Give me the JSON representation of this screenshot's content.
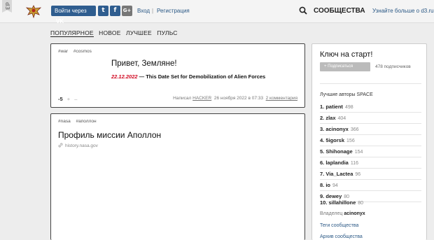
{
  "header": {
    "badge": "d3",
    "login_via": "Войти через",
    "login_vk": "VK",
    "twitter": "t",
    "facebook": "f",
    "gplus": "G+",
    "login": "Вход",
    "separator": "|",
    "register": "Регистрация",
    "communities": "СООБЩЕСТВА",
    "learn_more": "Узнайте больше о d3.ru"
  },
  "tabs": [
    "ПОПУЛЯРНОЕ",
    "НОВОЕ",
    "ЛУЧШЕЕ",
    "ПУЛЬС"
  ],
  "posts": [
    {
      "tags": [
        "#war",
        "#cosmos"
      ],
      "title": "Привет, Земляне!",
      "sub_date": "22.12.2022",
      "sub_text": " — This Date Set for Demobilization of Alien Forces",
      "rating": "-5",
      "vote_up": "+",
      "vote_down": "–",
      "meta_written": "Написал",
      "author": "HACKER",
      "date": "26 ноября 2022 в 07:33",
      "comments": "2 комментария"
    },
    {
      "tags": [
        "#nasa",
        "#аполлон"
      ],
      "title": "Профиль миссии Аполлон",
      "link": "history.nasa.gov"
    }
  ],
  "sidebar": {
    "title": "Ключ на старт!",
    "subscribe": "Подписаться",
    "subscribers": "478 подписчиков",
    "top_authors_heading": "Лучшие авторы SPACE",
    "authors": [
      {
        "name": "1. patient",
        "score": "498"
      },
      {
        "name": "2. zlax",
        "score": "404"
      },
      {
        "name": "3. acinonyx",
        "score": "366"
      },
      {
        "name": "4. 5igorsk",
        "score": "156"
      },
      {
        "name": "5. Shihonage",
        "score": "154"
      },
      {
        "name": "6. laplandia",
        "score": "116"
      },
      {
        "name": "7. Via_Lactea",
        "score": "96"
      },
      {
        "name": "8. io",
        "score": "94"
      },
      {
        "name": "9. dewey",
        "score": "80"
      },
      {
        "name": "10. sillahillone",
        "score": "80"
      }
    ],
    "owner_label": "Владелец",
    "owner": "acinonyx",
    "tags_link": "Теги сообщества",
    "archive_link": "Архив сообщества"
  },
  "colors": {
    "accent_blue": "#2f5d8f",
    "link": "#2a5885",
    "date_red": "#d0021b"
  }
}
